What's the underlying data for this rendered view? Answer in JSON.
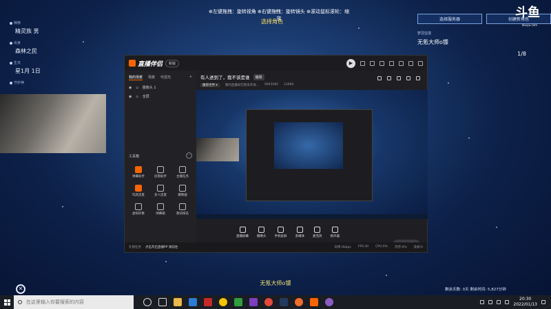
{
  "game": {
    "top_hint": "⊕左键拖拽：旋转视角  ⊕右键拖拽：旋转镜头  ⊕滚动鼠标滚轮：缩放",
    "title": "选择角色",
    "character_name_bottom": "无氪大师o镖",
    "left_panel": [
      {
        "label": "种族",
        "value": "精灵族 男"
      },
      {
        "label": "出身",
        "value": "森林之民"
      },
      {
        "label": "生日",
        "value": "星1月 1日"
      },
      {
        "label": "守护神",
        "value": ""
      }
    ],
    "right_panel": {
      "select_server": "选择服务器",
      "create_character": "创建新角色",
      "server_label": "梦羽宝境",
      "character_name": "无氪大师o镖",
      "page": "1/8"
    },
    "bottom_right_info": "剩余天数: 0天  剩余时间: 5,827分钟",
    "douyu_logo": "斗鱼",
    "douyu_sub": "douyu.com"
  },
  "app": {
    "name": "直播伴侣",
    "version": "新版",
    "tabs": [
      {
        "label": "我的场景",
        "active": true
      },
      {
        "label": "场景",
        "active": false
      },
      {
        "label": "可滤光",
        "active": false
      }
    ],
    "scenes": [
      {
        "label": "摄像头 1"
      },
      {
        "label": "全屏"
      }
    ],
    "tool_section_title": "工具箱",
    "tools": [
      {
        "label": "弹幕助手",
        "hot": true
      },
      {
        "label": "房管助手",
        "hot": false
      },
      {
        "label": "主播任务",
        "hot": false
      },
      {
        "label": "玩具连麦",
        "hot": false
      },
      {
        "label": "多人连麦",
        "hot": false
      },
      {
        "label": "摄像器",
        "hot": false
      },
      {
        "label": "虚拟形象",
        "hot": false
      },
      {
        "label": "弹幕箱",
        "hot": false
      },
      {
        "label": "歌词排名",
        "hot": false
      }
    ],
    "stream_title": "有人进到了，我不该是谁",
    "edit_label": "编辑",
    "category": "魔兽世界 ▾",
    "meta_text": "我的直播间在暂未开放...",
    "fans": "9945085",
    "hot": "23960",
    "controls": [
      {
        "label": "直播屏幕"
      },
      {
        "label": "摄像头"
      },
      {
        "label": "手机投屏"
      },
      {
        "label": "多媒体"
      },
      {
        "label": "麦克风"
      },
      {
        "label": "扬声器"
      }
    ],
    "live_button": "开始直播",
    "status_left": "礼物任务",
    "status_link": "点击开启直播PP 请前往",
    "status_right": "0帧",
    "stats": [
      "码率:0kbps",
      "FPS:30",
      "CPU:0%",
      "内存:0%",
      "丢帧:0"
    ]
  },
  "taskbar": {
    "search_placeholder": "在这里输入你要搜索的内容",
    "time": "20:30",
    "date": "2022/01/13"
  }
}
